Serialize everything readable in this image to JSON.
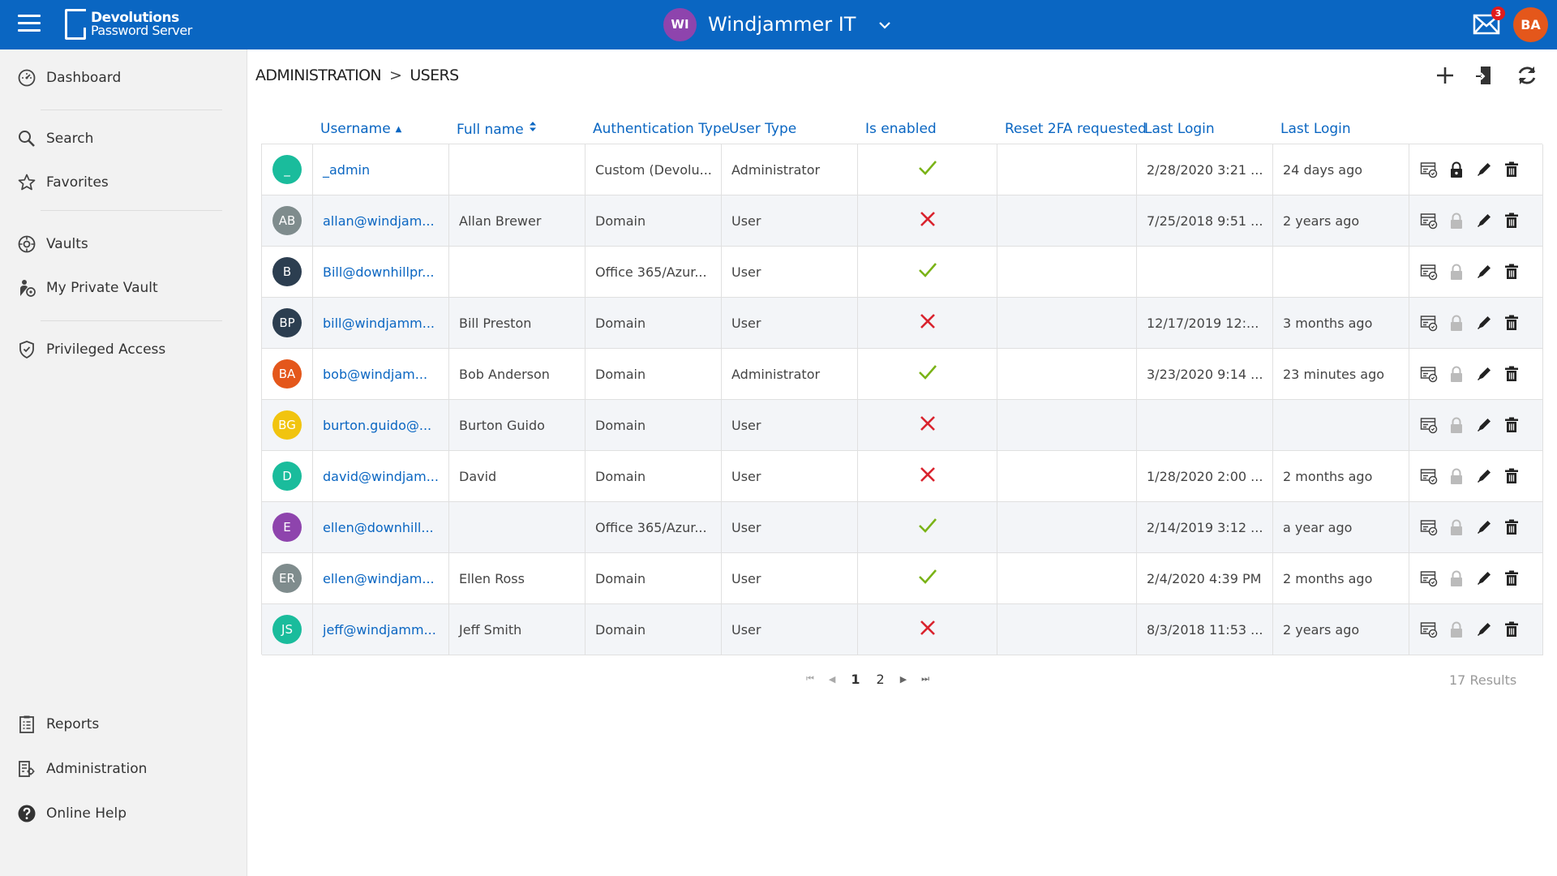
{
  "header": {
    "logo_line1": "Devolutions",
    "logo_line2": "Password Server",
    "workspace_initials": "WI",
    "workspace_name": "Windjammer IT",
    "workspace_color": "#8e44ad",
    "mail_count": "3",
    "user_initials": "BA",
    "user_color": "#e4571b",
    "brand_color": "#0a66c2"
  },
  "sidebar": {
    "dashboard": "Dashboard",
    "search": "Search",
    "favorites": "Favorites",
    "vaults": "Vaults",
    "private_vault": "My Private Vault",
    "privileged": "Privileged Access",
    "reports": "Reports",
    "administration": "Administration",
    "help": "Online Help"
  },
  "breadcrumb": {
    "section": "ADMINISTRATION",
    "separator": ">",
    "page": "USERS"
  },
  "table": {
    "columns": {
      "username": "Username",
      "fullname": "Full name",
      "auth": "Authentication Type",
      "usertype": "User Type",
      "enabled": "Is enabled",
      "reset2fa": "Reset 2FA requested",
      "lastlogin": "Last Login",
      "lastlogin_rel": "Last Login"
    },
    "rows": [
      {
        "initials": "_",
        "color": "#1abc9c",
        "username": "_admin",
        "fullname": "",
        "auth": "Custom (Devolu...",
        "usertype": "Administrator",
        "enabled": true,
        "reset2fa": "",
        "lastlogin": "2/28/2020 3:21 ...",
        "lastlogin_rel": "24 days ago",
        "locked": true
      },
      {
        "initials": "AB",
        "color": "#7f8c8d",
        "username": "allan@windjam...",
        "fullname": "Allan Brewer",
        "auth": "Domain",
        "usertype": "User",
        "enabled": false,
        "reset2fa": "",
        "lastlogin": "7/25/2018 9:51 ...",
        "lastlogin_rel": "2 years ago",
        "locked": false
      },
      {
        "initials": "B",
        "color": "#2c3e50",
        "username": "Bill@downhillpr...",
        "fullname": "",
        "auth": "Office 365/Azur...",
        "usertype": "User",
        "enabled": true,
        "reset2fa": "",
        "lastlogin": "",
        "lastlogin_rel": "",
        "locked": false
      },
      {
        "initials": "BP",
        "color": "#2c3e50",
        "username": "bill@windjamm...",
        "fullname": "Bill Preston",
        "auth": "Domain",
        "usertype": "User",
        "enabled": false,
        "reset2fa": "",
        "lastlogin": "12/17/2019 12:...",
        "lastlogin_rel": "3 months ago",
        "locked": false
      },
      {
        "initials": "BA",
        "color": "#e4571b",
        "username": "bob@windjam...",
        "fullname": "Bob Anderson",
        "auth": "Domain",
        "usertype": "Administrator",
        "enabled": true,
        "reset2fa": "",
        "lastlogin": "3/23/2020 9:14 ...",
        "lastlogin_rel": "23 minutes ago",
        "locked": false
      },
      {
        "initials": "BG",
        "color": "#f1c40f",
        "username": "burton.guido@...",
        "fullname": "Burton Guido",
        "auth": "Domain",
        "usertype": "User",
        "enabled": false,
        "reset2fa": "",
        "lastlogin": "",
        "lastlogin_rel": "",
        "locked": false
      },
      {
        "initials": "D",
        "color": "#1abc9c",
        "username": "david@windjam...",
        "fullname": "David",
        "auth": "Domain",
        "usertype": "User",
        "enabled": false,
        "reset2fa": "",
        "lastlogin": "1/28/2020 2:00 ...",
        "lastlogin_rel": "2 months ago",
        "locked": false
      },
      {
        "initials": "E",
        "color": "#8e44ad",
        "username": "ellen@downhill...",
        "fullname": "",
        "auth": "Office 365/Azur...",
        "usertype": "User",
        "enabled": true,
        "reset2fa": "",
        "lastlogin": "2/14/2019 3:12 ...",
        "lastlogin_rel": "a year ago",
        "locked": false
      },
      {
        "initials": "ER",
        "color": "#7f8c8d",
        "username": "ellen@windjam...",
        "fullname": "Ellen Ross",
        "auth": "Domain",
        "usertype": "User",
        "enabled": true,
        "reset2fa": "",
        "lastlogin": "2/4/2020 4:39 PM",
        "lastlogin_rel": "2 months ago",
        "locked": false
      },
      {
        "initials": "JS",
        "color": "#1abc9c",
        "username": "jeff@windjamm...",
        "fullname": "Jeff Smith",
        "auth": "Domain",
        "usertype": "User",
        "enabled": false,
        "reset2fa": "",
        "lastlogin": "8/3/2018 11:53 ...",
        "lastlogin_rel": "2 years ago",
        "locked": false
      }
    ]
  },
  "pagination": {
    "pages": [
      "1",
      "2"
    ],
    "current": "1",
    "results": "17 Results"
  },
  "colors": {
    "check": "#7ab317",
    "cross": "#d9232e"
  }
}
